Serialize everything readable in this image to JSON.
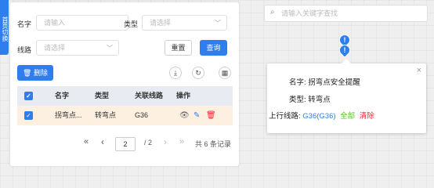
{
  "side_tab": {
    "label": "首页切换"
  },
  "filters": {
    "name_label": "名字",
    "name_placeholder": "请输入",
    "type_label": "类型",
    "type_placeholder": "请选择",
    "line_label": "线路",
    "line_placeholder": "请选择"
  },
  "buttons": {
    "reset": "重置",
    "query": "查询",
    "delete": "删除"
  },
  "icons": {
    "delete": "trash-icon",
    "download": "download-icon",
    "refresh": "refresh-icon",
    "columns": "grid-icon",
    "view": "eye-icon",
    "edit": "edit-icon",
    "remove": "trash-icon",
    "search": "search-icon",
    "close": "close-icon"
  },
  "table": {
    "columns": [
      "名字",
      "类型",
      "关联线路",
      "操作"
    ],
    "rows": [
      {
        "name": "拐弯点...",
        "type": "转弯点",
        "line": "G36"
      }
    ]
  },
  "pagination": {
    "first": "«",
    "prev": "‹",
    "current": "2",
    "total": "/ 2",
    "next": "›",
    "last": "»",
    "summary": "共 6 条记录"
  },
  "map": {
    "search_placeholder": "请输入关键字查找",
    "marker_glyph": "!"
  },
  "popup": {
    "name_label": "名字:",
    "name_value": "拐弯点安全提醒",
    "type_label": "类型:",
    "type_value": "转弯点",
    "line_label": "上行线路:",
    "line_value": "G36(G36)",
    "all_link": "全部",
    "clear_link": "清除",
    "close": "×"
  },
  "colors": {
    "primary": "#2f7ef0",
    "success": "#52c41a",
    "danger": "#f5222d",
    "selected_row": "#fdf0e0"
  }
}
